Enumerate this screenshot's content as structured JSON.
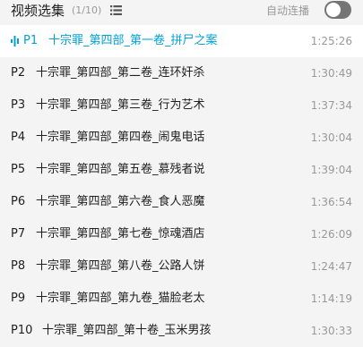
{
  "header": {
    "title": "视频选集",
    "count": "(1/10)",
    "list_icon": "list-icon",
    "autoplay_label": "自动连播",
    "autoplay_on": false
  },
  "colors": {
    "active": "#00a1d6",
    "text": "#212121",
    "muted": "#999999",
    "background": "#f4f4f4",
    "active_row_background": "#ffffff",
    "toggle_off": "#757575"
  },
  "episodes": [
    {
      "index": "P1",
      "title": "十宗罪_第四部_第一卷_拼尸之案",
      "duration": "1:25:26",
      "active": true,
      "icon": "playing-wave-icon"
    },
    {
      "index": "P2",
      "title": "十宗罪_第四部_第二卷_连环奸杀",
      "duration": "1:30:49",
      "active": false
    },
    {
      "index": "P3",
      "title": "十宗罪_第四部_第三卷_行为艺术",
      "duration": "1:37:34",
      "active": false
    },
    {
      "index": "P4",
      "title": "十宗罪_第四部_第四卷_闹鬼电话",
      "duration": "1:30:04",
      "active": false
    },
    {
      "index": "P5",
      "title": "十宗罪_第四部_第五卷_慕残者说",
      "duration": "1:39:04",
      "active": false
    },
    {
      "index": "P6",
      "title": "十宗罪_第四部_第六卷_食人恶魔",
      "duration": "1:36:54",
      "active": false
    },
    {
      "index": "P7",
      "title": "十宗罪_第四部_第七卷_惊魂酒店",
      "duration": "1:26:09",
      "active": false
    },
    {
      "index": "P8",
      "title": "十宗罪_第四部_第八卷_公路人饼",
      "duration": "1:24:47",
      "active": false
    },
    {
      "index": "P9",
      "title": "十宗罪_第四部_第九卷_猫脸老太",
      "duration": "1:14:19",
      "active": false
    },
    {
      "index": "P10",
      "title": "十宗罪_第四部_第十卷_玉米男孩",
      "duration": "1:30:33",
      "active": false
    }
  ]
}
